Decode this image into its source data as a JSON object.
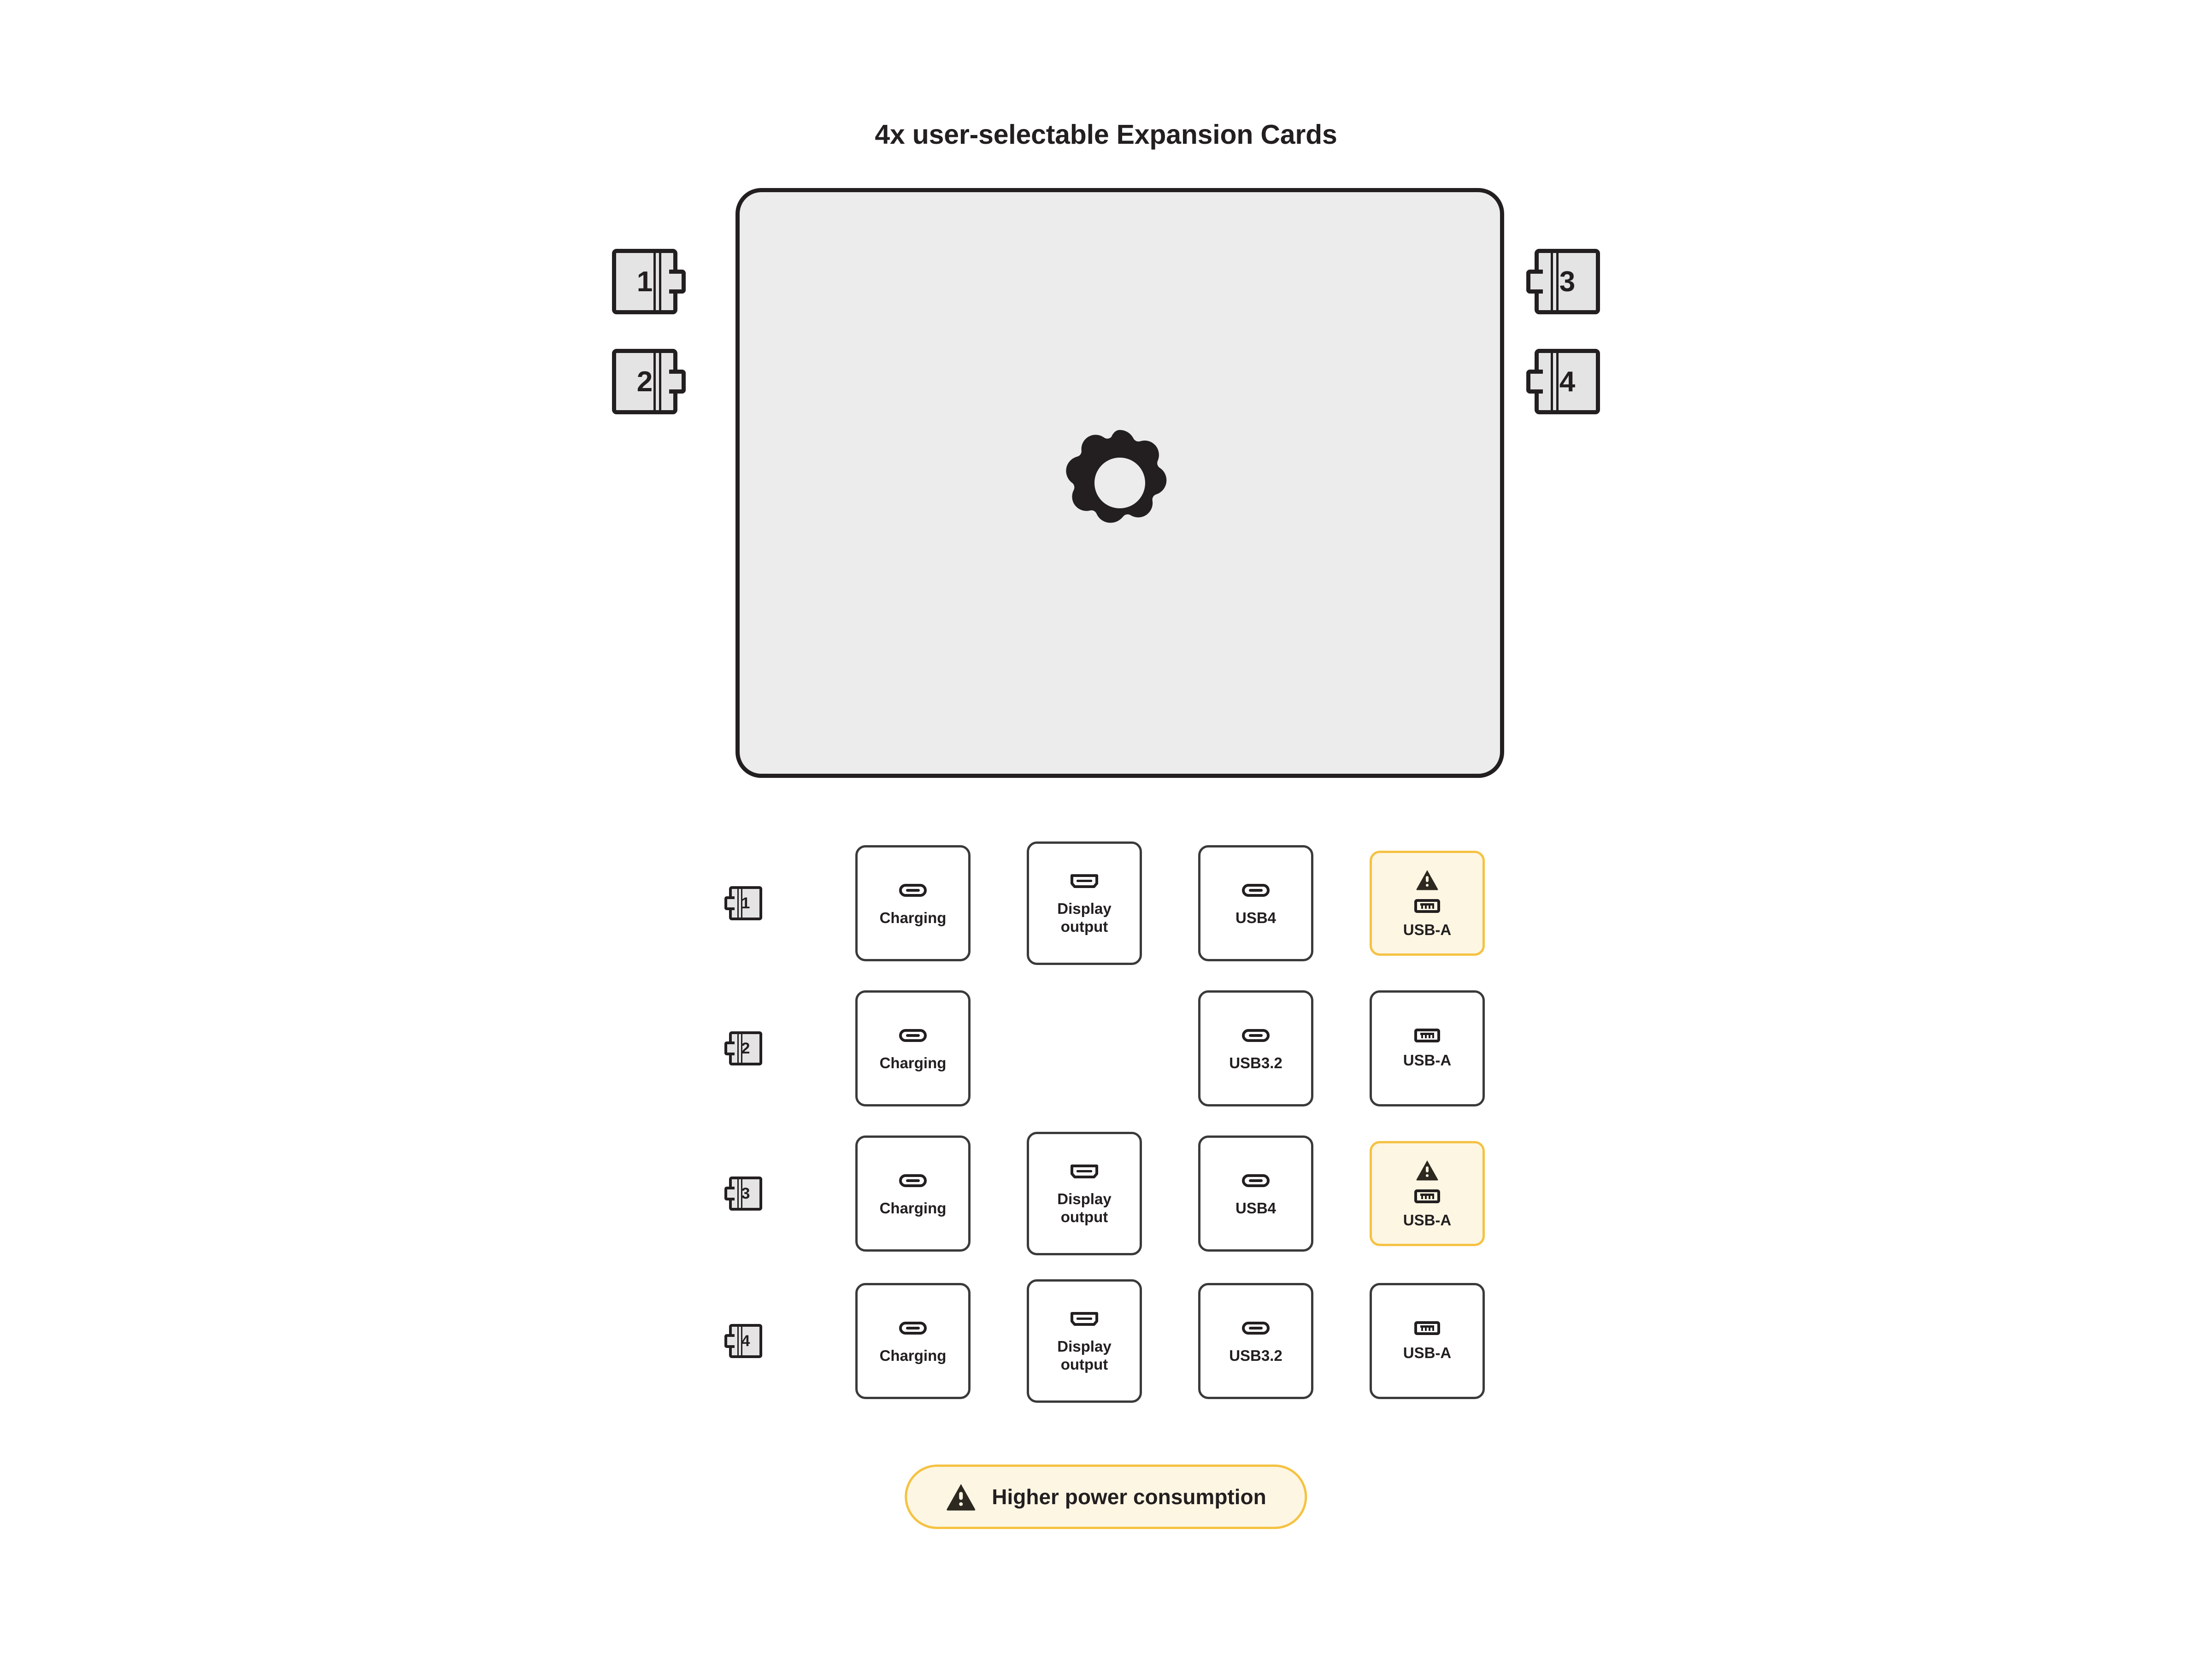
{
  "title": "4x user-selectable Expansion Cards",
  "device": {
    "logo_icon": "framework-gear-logo",
    "fill_color": "#ECECEC",
    "stroke_color": "#231F20"
  },
  "expansion_cards": [
    {
      "label": "1",
      "side": "left"
    },
    {
      "label": "2",
      "side": "left"
    },
    {
      "label": "3",
      "side": "right"
    },
    {
      "label": "4",
      "side": "right"
    }
  ],
  "colors": {
    "warning_fill": "#FDF6E3",
    "warning_border": "#F5C242",
    "card_fill": "#E4E4E4",
    "stroke": "#231F20",
    "port_border": "#3A3A3A",
    "background": "#FFFFFF"
  },
  "port_matrix": {
    "rows": [
      {
        "badge": "1",
        "cells": [
          {
            "label": "Charging",
            "icon": "usb-c-icon",
            "warning": false,
            "empty": false
          },
          {
            "label": "Display\noutput",
            "icon": "display-port-icon",
            "warning": false,
            "empty": false
          },
          {
            "label": "USB4",
            "icon": "usb-c-icon",
            "warning": false,
            "empty": false
          },
          {
            "label": "USB-A",
            "icon": "usb-a-icon",
            "warning": true,
            "empty": false
          }
        ]
      },
      {
        "badge": "2",
        "cells": [
          {
            "label": "Charging",
            "icon": "usb-c-icon",
            "warning": false,
            "empty": false
          },
          {
            "label": "",
            "icon": "",
            "warning": false,
            "empty": true
          },
          {
            "label": "USB3.2",
            "icon": "usb-c-icon",
            "warning": false,
            "empty": false
          },
          {
            "label": "USB-A",
            "icon": "usb-a-icon",
            "warning": false,
            "empty": false
          }
        ]
      },
      {
        "badge": "3",
        "cells": [
          {
            "label": "Charging",
            "icon": "usb-c-icon",
            "warning": false,
            "empty": false
          },
          {
            "label": "Display\noutput",
            "icon": "display-port-icon",
            "warning": false,
            "empty": false
          },
          {
            "label": "USB4",
            "icon": "usb-c-icon",
            "warning": false,
            "empty": false
          },
          {
            "label": "USB-A",
            "icon": "usb-a-icon",
            "warning": true,
            "empty": false
          }
        ]
      },
      {
        "badge": "4",
        "cells": [
          {
            "label": "Charging",
            "icon": "usb-c-icon",
            "warning": false,
            "empty": false
          },
          {
            "label": "Display\noutput",
            "icon": "display-port-icon",
            "warning": false,
            "empty": false
          },
          {
            "label": "USB3.2",
            "icon": "usb-c-icon",
            "warning": false,
            "empty": false
          },
          {
            "label": "USB-A",
            "icon": "usb-a-icon",
            "warning": false,
            "empty": false
          }
        ]
      }
    ]
  },
  "legend": {
    "icon": "warning-triangle-icon",
    "text": "Higher power consumption"
  }
}
